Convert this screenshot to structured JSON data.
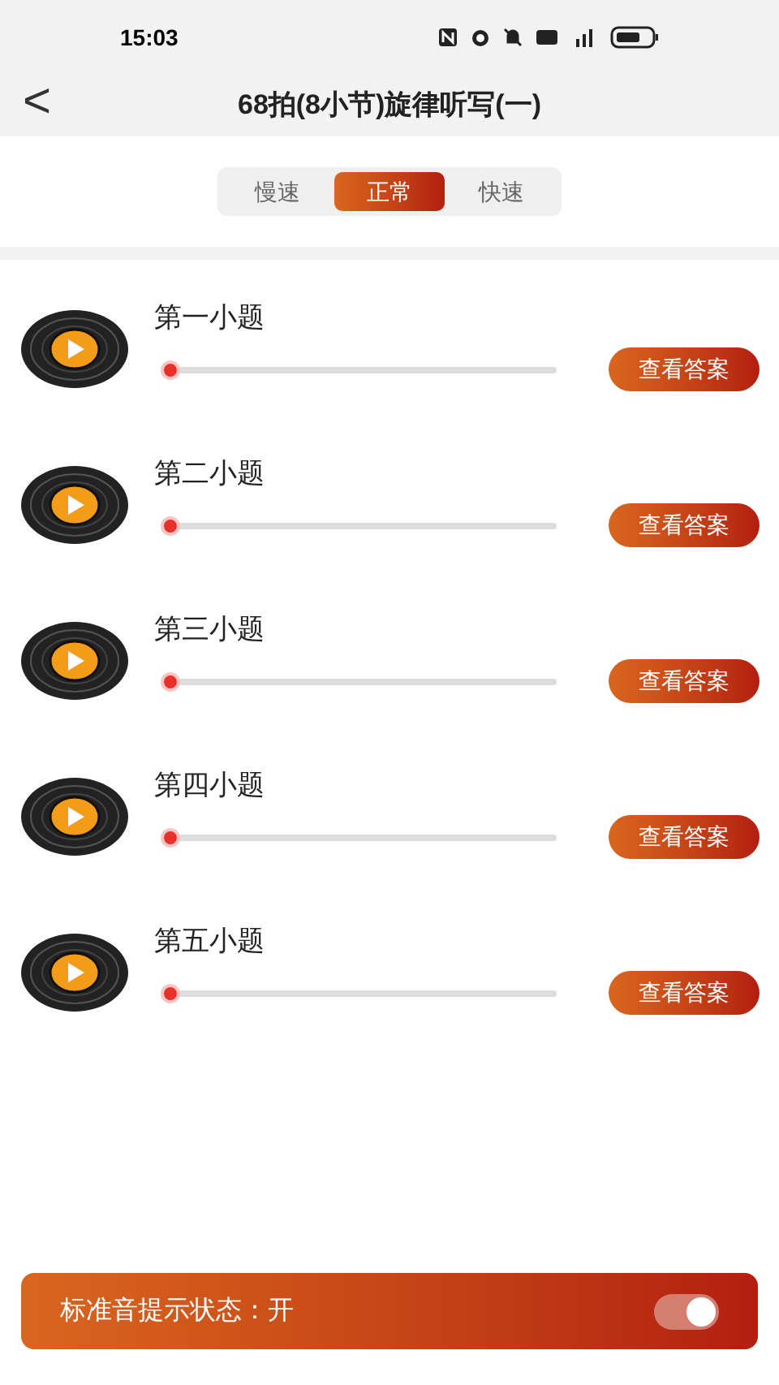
{
  "status_bar": {
    "time": "15:03"
  },
  "header": {
    "back": "<",
    "title": "68拍(8小节)旋律听写(一)"
  },
  "speed_tabs": [
    {
      "label": "慢速",
      "selected": false
    },
    {
      "label": "正常",
      "selected": true
    },
    {
      "label": "快速",
      "selected": false
    }
  ],
  "questions": [
    {
      "title": "第一小题",
      "level": 0,
      "button": "查看答案"
    },
    {
      "title": "第二小题",
      "level": 0,
      "button": "查看答案"
    },
    {
      "title": "第三小题",
      "level": 0,
      "button": "查看答案"
    },
    {
      "title": "第四小题",
      "level": 0,
      "button": "查看答案"
    },
    {
      "title": "第五小题",
      "level": 0,
      "button": "查看答案"
    }
  ],
  "bottom_bar": {
    "label": "标准音提示状态：开",
    "on": true
  }
}
